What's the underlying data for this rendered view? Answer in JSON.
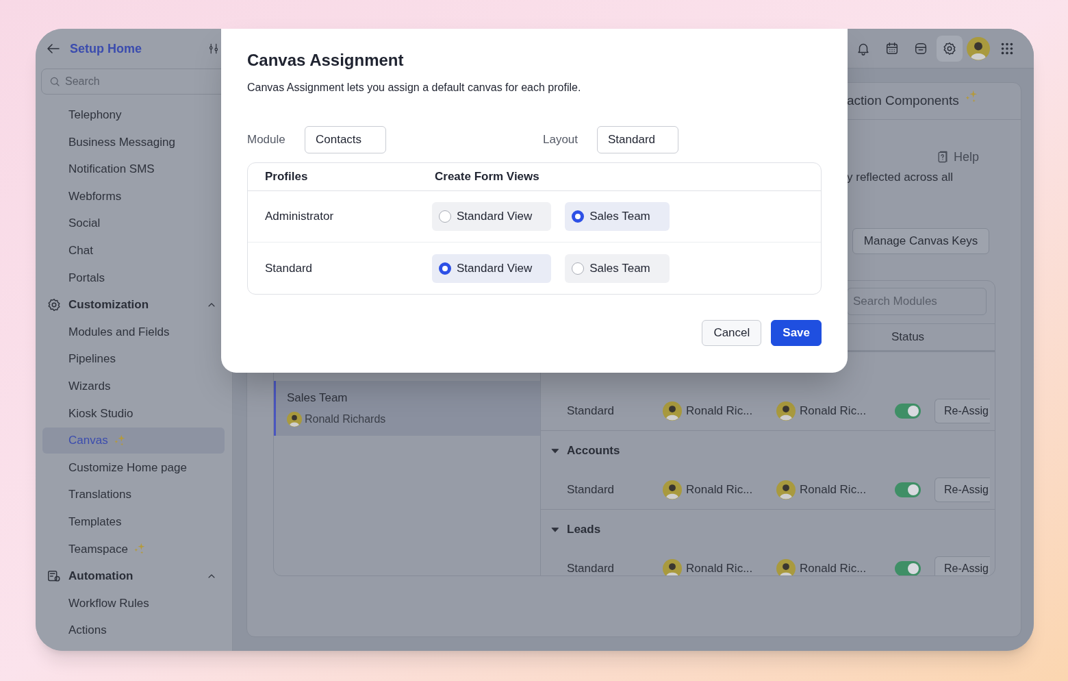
{
  "top_bar": {
    "icons": [
      {
        "kind": "bell",
        "selected": false
      },
      {
        "kind": "calendar",
        "selected": false
      },
      {
        "kind": "store",
        "selected": false
      },
      {
        "kind": "settings",
        "selected": true
      },
      {
        "kind": "avatar",
        "selected": false
      },
      {
        "kind": "apps",
        "selected": false
      }
    ]
  },
  "sidebar": {
    "title": "Setup Home",
    "search": {
      "placeholder": "Search"
    },
    "items": [
      {
        "kind": "item",
        "label": "Telephony",
        "selected": false,
        "new": false
      },
      {
        "kind": "item",
        "label": "Business Messaging",
        "selected": false,
        "new": false
      },
      {
        "kind": "item",
        "label": "Notification SMS",
        "selected": false,
        "new": false
      },
      {
        "kind": "item",
        "label": "Webforms",
        "selected": false,
        "new": false
      },
      {
        "kind": "item",
        "label": "Social",
        "selected": false,
        "new": false
      },
      {
        "kind": "item",
        "label": "Chat",
        "selected": false,
        "new": false
      },
      {
        "kind": "item",
        "label": "Portals",
        "selected": false,
        "new": false
      },
      {
        "kind": "section",
        "label": "Customization",
        "expanded": true
      },
      {
        "kind": "item",
        "label": "Modules and Fields",
        "selected": false,
        "new": false
      },
      {
        "kind": "item",
        "label": "Pipelines",
        "selected": false,
        "new": false
      },
      {
        "kind": "item",
        "label": "Wizards",
        "selected": false,
        "new": false
      },
      {
        "kind": "item",
        "label": "Kiosk Studio",
        "selected": false,
        "new": false
      },
      {
        "kind": "item",
        "label": "Canvas",
        "selected": true,
        "new": true
      },
      {
        "kind": "item",
        "label": "Customize Home page",
        "selected": false,
        "new": false
      },
      {
        "kind": "item",
        "label": "Translations",
        "selected": false,
        "new": false
      },
      {
        "kind": "item",
        "label": "Templates",
        "selected": false,
        "new": false
      },
      {
        "kind": "item",
        "label": "Teamspace",
        "selected": false,
        "new": true
      },
      {
        "kind": "section",
        "label": "Automation",
        "expanded": true
      },
      {
        "kind": "item",
        "label": "Workflow Rules",
        "selected": false,
        "new": false
      },
      {
        "kind": "item",
        "label": "Actions",
        "selected": false,
        "new": false
      }
    ]
  },
  "main": {
    "tab_title": "action Components",
    "tab_new": true,
    "help": "Help",
    "description": "y reflected across all",
    "manage_button": "Manage Canvas Keys",
    "search_modules": {
      "placeholder": "Search Modules"
    },
    "columns": [
      "Status"
    ],
    "profiles": [
      {
        "name": "Sales Team",
        "owner": "Ronald Richards",
        "selected": true
      }
    ],
    "groups": [
      {
        "rows": [
          {
            "layout": "Standard",
            "created_by": "Ronald Ric...",
            "modified_by": "Ronald Ric...",
            "active": true,
            "action": "Re-Assig"
          }
        ]
      },
      {
        "name": "Accounts",
        "expanded": true,
        "rows": [
          {
            "layout": "Standard",
            "created_by": "Ronald Ric...",
            "modified_by": "Ronald Ric...",
            "active": true,
            "action": "Re-Assig"
          }
        ]
      },
      {
        "name": "Leads",
        "expanded": true,
        "rows": [
          {
            "layout": "Standard",
            "created_by": "Ronald Ric...",
            "modified_by": "Ronald Ric...",
            "active": true,
            "action": "Re-Assig"
          }
        ]
      }
    ]
  },
  "modal": {
    "title": "Canvas Assignment",
    "description": "Canvas Assignment lets you assign a default canvas for each profile.",
    "module": {
      "label": "Module",
      "value": "Contacts"
    },
    "layout": {
      "label": "Layout",
      "value": "Standard"
    },
    "columns": [
      "Profiles",
      "Create Form Views"
    ],
    "rows": [
      {
        "profile": "Administrator",
        "options": [
          {
            "label": "Standard View",
            "selected": false
          },
          {
            "label": "Sales Team",
            "selected": true
          }
        ]
      },
      {
        "profile": "Standard",
        "options": [
          {
            "label": "Standard View",
            "selected": true
          },
          {
            "label": "Sales Team",
            "selected": false
          }
        ]
      }
    ],
    "buttons": [
      {
        "kind": "secondary",
        "label": "Cancel"
      },
      {
        "kind": "primary",
        "label": "Save"
      }
    ]
  }
}
